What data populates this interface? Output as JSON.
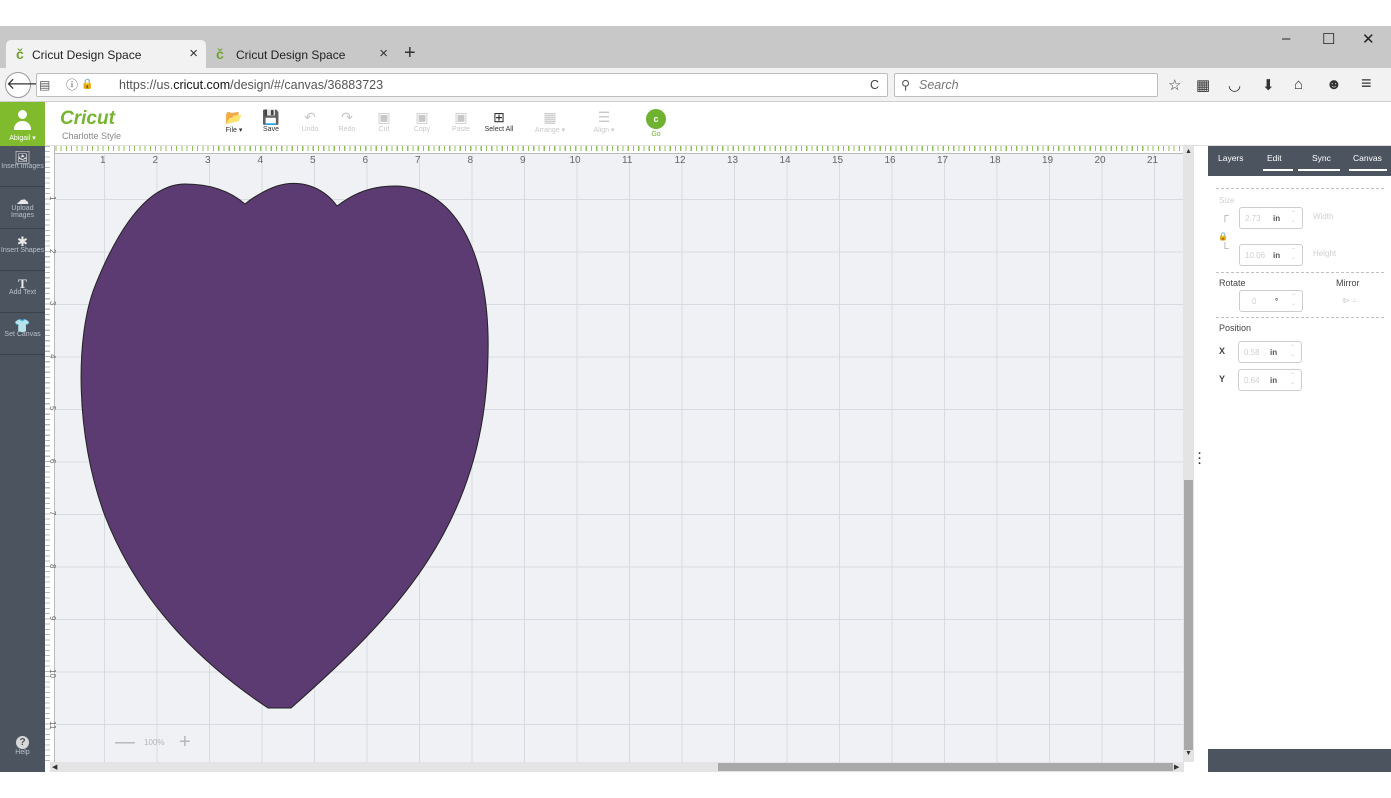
{
  "browser": {
    "tabs": [
      {
        "title": "Cricut Design Space",
        "icon": "cricut-favicon",
        "glyph": "č"
      },
      {
        "title": "Cricut Design Space",
        "icon": "cricut-favicon",
        "glyph": "č"
      }
    ],
    "tab_close": "×",
    "new_tab": "+",
    "window_controls": {
      "minimize": "–",
      "maximize": "☐",
      "close": "✕"
    },
    "url_prefix": "https://us.",
    "url_domain": "cricut.com",
    "url_path": "/design/#/canvas/36883723",
    "search_placeholder": "Search",
    "icons": {
      "back": "🡐",
      "page": "▤",
      "info": "ⓘ",
      "lock": "🔒",
      "reload": "C",
      "search": "⚲",
      "star": "☆",
      "reading_list": "▦",
      "pocket": "◡",
      "download": "⬇",
      "home": "⌂",
      "emoji": "☻",
      "menu": "≡"
    }
  },
  "app": {
    "user_name": "Abigail ▾",
    "logo": "Cricut",
    "project_name": "Charlotte Style",
    "toolbar": [
      {
        "label": "File ▾",
        "icon": "📂",
        "enabled": true
      },
      {
        "label": "Save",
        "icon": "💾",
        "enabled": true
      },
      {
        "label": "Undo",
        "icon": "↶",
        "enabled": false
      },
      {
        "label": "Redo",
        "icon": "↷",
        "enabled": false
      },
      {
        "label": "Cut",
        "icon": "▣",
        "enabled": false
      },
      {
        "label": "Copy",
        "icon": "▣",
        "enabled": false
      },
      {
        "label": "Paste",
        "icon": "▣",
        "enabled": false
      },
      {
        "label": "Select All",
        "icon": "⊞",
        "enabled": true
      },
      {
        "label": "Arrange ▾",
        "icon": "▦",
        "enabled": false
      },
      {
        "label": "Align ▾",
        "icon": "☰",
        "enabled": false
      }
    ],
    "go": {
      "icon": "c",
      "label": "Go"
    },
    "sidebar": [
      {
        "label": "Insert Images",
        "icon": "🖼"
      },
      {
        "label": "Upload Images",
        "icon": "☁"
      },
      {
        "label": "Insert Shapes",
        "icon": "✱"
      },
      {
        "label": "Add Text",
        "icon": "T"
      },
      {
        "label": "Set Canvas",
        "icon": "👕"
      }
    ],
    "help": {
      "label": "Help",
      "icon": "?"
    },
    "ruler_h": [
      "1",
      "2",
      "3",
      "4",
      "5",
      "6",
      "7",
      "8",
      "9",
      "10",
      "11",
      "12",
      "13",
      "14",
      "15",
      "16",
      "17",
      "18",
      "19",
      "20",
      "21"
    ],
    "ruler_v": [
      "1",
      "2",
      "3",
      "4",
      "5",
      "6",
      "7",
      "8",
      "9",
      "10",
      "11"
    ],
    "zoom": {
      "minus": "—",
      "value": "100%",
      "plus": "+"
    },
    "shape_color": "#5b3b72",
    "accent": "#7fbb2d",
    "panel": {
      "tabs": [
        "Layers",
        "Edit",
        "Sync",
        "Canvas"
      ],
      "active_tab": "Edit",
      "size_label": "Size",
      "width": {
        "value": "2.73",
        "unit": "in",
        "label": "Width"
      },
      "height": {
        "value": "10.06",
        "unit": "in",
        "label": "Height"
      },
      "rotate_label": "Rotate",
      "rotate_value": "0",
      "rotate_unit": "°",
      "mirror_label": "Mirror",
      "mirror_icons": "⧐ ⩡",
      "position_label": "Position",
      "x": {
        "label": "X",
        "value": "0.58",
        "unit": "in"
      },
      "y": {
        "label": "Y",
        "value": "0.64",
        "unit": "in"
      }
    }
  }
}
